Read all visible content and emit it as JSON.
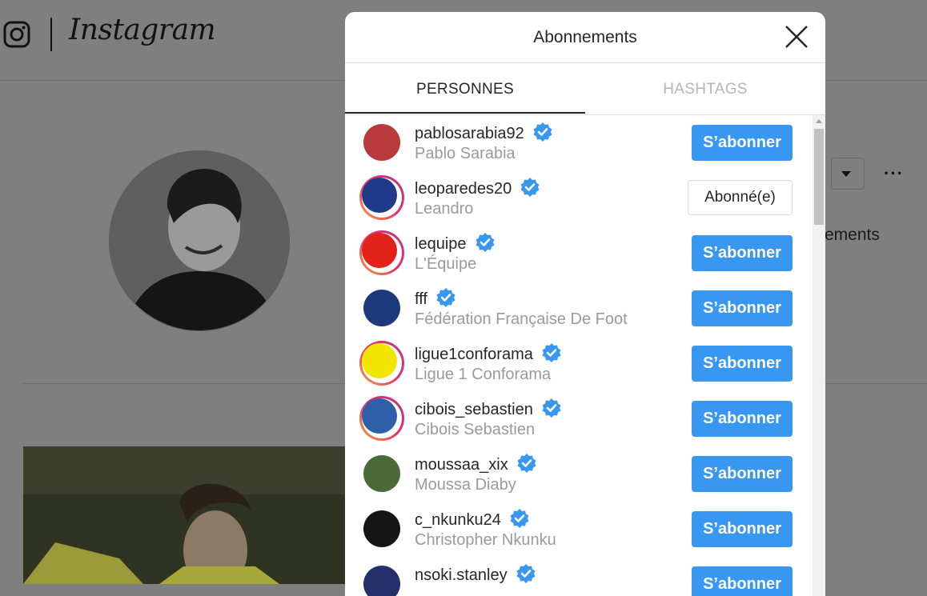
{
  "app": {
    "name": "Instagram"
  },
  "background": {
    "partial_stat_text": "ements"
  },
  "modal": {
    "title": "Abonnements",
    "tabs": [
      {
        "label": "PERSONNES",
        "active": true
      },
      {
        "label": "HASHTAGS",
        "active": false
      }
    ],
    "accounts": [
      {
        "username": "pablosarabia92",
        "full_name": "Pablo Sarabia",
        "verified": true,
        "button": "S’abonner",
        "story_ring": false,
        "avatar_color": "#b83a3a"
      },
      {
        "username": "leoparedes20",
        "full_name": "Leandro",
        "verified": true,
        "button": "Abonné(e)",
        "story_ring": true,
        "avatar_color": "#1f3a8a"
      },
      {
        "username": "lequipe",
        "full_name": "L'Équipe",
        "verified": true,
        "button": "S’abonner",
        "story_ring": true,
        "avatar_color": "#e2231a"
      },
      {
        "username": "fff",
        "full_name": "Fédération Française De Foot",
        "verified": true,
        "button": "S’abonner",
        "story_ring": false,
        "avatar_color": "#1d3a7a"
      },
      {
        "username": "ligue1conforama",
        "full_name": "Ligue 1 Conforama",
        "verified": true,
        "button": "S’abonner",
        "story_ring": true,
        "avatar_color": "#f2e600"
      },
      {
        "username": "cibois_sebastien",
        "full_name": "Cibois Sebastien",
        "verified": true,
        "button": "S’abonner",
        "story_ring": true,
        "avatar_color": "#2e5fa8"
      },
      {
        "username": "moussaa_xix",
        "full_name": "Moussa Diaby",
        "verified": true,
        "button": "S’abonner",
        "story_ring": false,
        "avatar_color": "#4a6a3a"
      },
      {
        "username": "c_nkunku24",
        "full_name": "Christopher Nkunku",
        "verified": true,
        "button": "S’abonner",
        "story_ring": false,
        "avatar_color": "#151515"
      },
      {
        "username": "nsoki.stanley",
        "full_name": "",
        "verified": true,
        "button": "S’abonner",
        "story_ring": false,
        "avatar_color": "#23306a"
      }
    ]
  },
  "colors": {
    "accent": "#3897f0",
    "overlay": "#7f7f7f",
    "verified": "#3897f0"
  }
}
